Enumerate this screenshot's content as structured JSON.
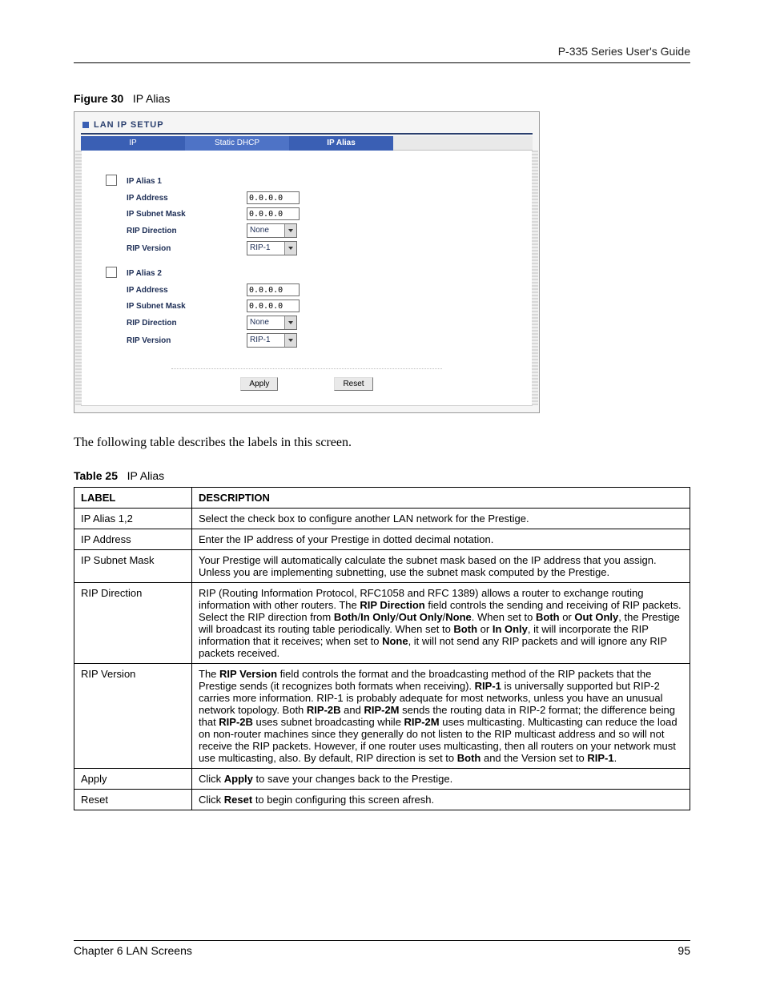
{
  "header": {
    "running": "P-335 Series User's Guide"
  },
  "figure": {
    "label": "Figure 30",
    "title": "IP Alias"
  },
  "ss": {
    "panel_title": "LAN IP SETUP",
    "tabs": [
      "IP",
      "Static DHCP",
      "IP Alias"
    ],
    "groups": [
      {
        "title": "IP Alias 1",
        "fields": {
          "ip_addr_label": "IP Address",
          "ip_addr_value": "0.0.0.0",
          "subnet_label": "IP Subnet Mask",
          "subnet_value": "0.0.0.0",
          "rip_dir_label": "RIP Direction",
          "rip_dir_value": "None",
          "rip_ver_label": "RIP Version",
          "rip_ver_value": "RIP-1"
        }
      },
      {
        "title": "IP Alias 2",
        "fields": {
          "ip_addr_label": "IP Address",
          "ip_addr_value": "0.0.0.0",
          "subnet_label": "IP Subnet Mask",
          "subnet_value": "0.0.0.0",
          "rip_dir_label": "RIP Direction",
          "rip_dir_value": "None",
          "rip_ver_label": "RIP Version",
          "rip_ver_value": "RIP-1"
        }
      }
    ],
    "buttons": {
      "apply": "Apply",
      "reset": "Reset"
    }
  },
  "intro": "The following table describes the labels in this screen.",
  "table": {
    "label": "Table 25",
    "title": "IP Alias",
    "head": {
      "c1": "LABEL",
      "c2": "DESCRIPTION"
    },
    "rows": [
      {
        "l": "IP Alias 1,2",
        "d": "Select the check box to configure another LAN network for the Prestige."
      },
      {
        "l": "IP Address",
        "d": "Enter the IP address of your Prestige in dotted decimal notation."
      },
      {
        "l": "IP Subnet Mask",
        "d": "Your Prestige will automatically calculate the subnet mask based on the IP address that you assign. Unless you are implementing subnetting, use the subnet mask computed by the Prestige."
      },
      {
        "l": "RIP Direction",
        "d_html": "RIP (Routing Information Protocol, RFC1058 and RFC 1389) allows a router to exchange routing information with other routers. The <b>RIP Direction</b> field controls the sending and receiving of RIP packets. Select the RIP direction from <b>Both</b>/<b>In Only</b>/<b>Out Only</b>/<b>None</b>. When set to <b>Both</b> or <b>Out Only</b>, the Prestige will broadcast its routing table periodically. When set to <b>Both</b> or <b>In Only</b>, it will incorporate the RIP information that it receives; when set to <b>None</b>, it will not send any RIP packets and will ignore any RIP packets received."
      },
      {
        "l": "RIP Version",
        "d_html": "The <b>RIP Version</b> field controls the format and the broadcasting method of the RIP packets that the Prestige sends (it recognizes both formats when receiving). <b>RIP-1</b> is universally supported but RIP-2 carries more information. RIP-1 is probably adequate for most networks, unless you have an unusual network topology. Both <b>RIP-2B</b> and <b>RIP-2M</b> sends the routing data in RIP-2 format; the difference being that <b>RIP-2B</b> uses subnet broadcasting while <b>RIP-2M</b> uses multicasting. Multicasting can reduce the load on non-router machines since they generally do not listen to the RIP multicast address and so will not receive the RIP packets. However, if one router uses multicasting, then all routers on your network must use multicasting, also. By default, RIP direction is set to <b>Both</b> and the Version set to <b>RIP-1</b>."
      },
      {
        "l": "Apply",
        "d_html": "Click <b>Apply</b> to save your changes back to the Prestige."
      },
      {
        "l": "Reset",
        "d_html": "Click <b>Reset</b> to begin configuring this screen afresh."
      }
    ]
  },
  "footer": {
    "left": "Chapter 6 LAN Screens",
    "right": "95"
  }
}
